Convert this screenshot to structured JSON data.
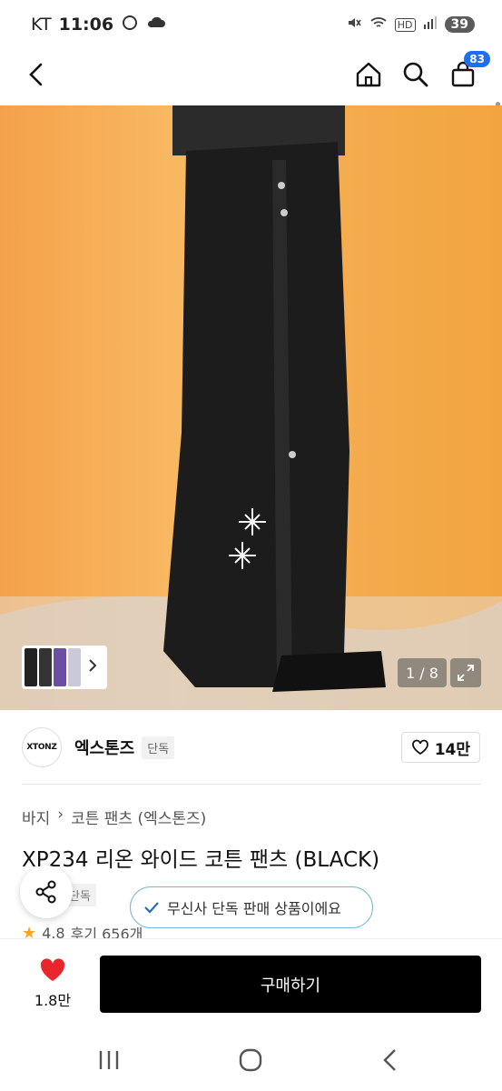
{
  "status_bar": {
    "carrier": "KT",
    "time": "11:06",
    "battery": "39",
    "network": "HD"
  },
  "nav": {
    "cart_count": "83"
  },
  "hero": {
    "pager": "1 / 8"
  },
  "brand": {
    "logo_text": "XTONZ",
    "name": "엑스톤즈",
    "exclusive_tag": "단독",
    "likes": "14만"
  },
  "breadcrumb": {
    "items": [
      "바지",
      "코튼 팬츠 (엑스톤즈)"
    ]
  },
  "product": {
    "title": "XP234 리온 와이드 코튼 팬츠 (BLACK)",
    "exclusive_tag": "단독",
    "rating": "4.8",
    "reviews": "후기 656개"
  },
  "toast": {
    "text": "무신사 단독 판매 상품이에요"
  },
  "bottom_bar": {
    "heart_count": "1.8만",
    "buy_label": "구매하기"
  },
  "colors": {
    "accent": "#1e6ff0",
    "heart": "#e8262b",
    "buy_button": "#000000"
  }
}
